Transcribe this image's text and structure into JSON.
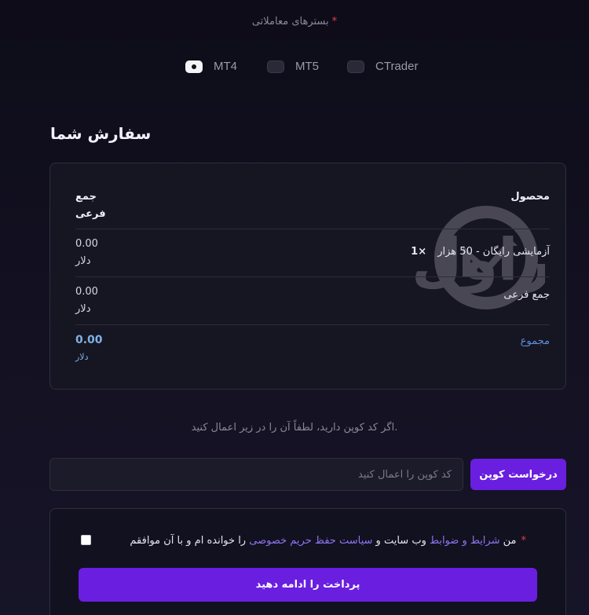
{
  "platform_field": {
    "label": "بسترهای معاملاتی",
    "required_mark": "*",
    "options": [
      {
        "label": "MT4",
        "checked": true
      },
      {
        "label": "MT5",
        "checked": false
      },
      {
        "label": "CTrader",
        "checked": false
      }
    ]
  },
  "order": {
    "title": "سفارش شما",
    "watermark_text": "بروکراول",
    "header": {
      "product": "محصول",
      "subtotal_line1": "جمع",
      "subtotal_line2": "فرعی"
    },
    "item": {
      "name": "آزمایشی رایگان - 50 هزار",
      "qty": "×1",
      "amount": "0.00",
      "currency": "دلار"
    },
    "subtotal": {
      "label": "جمع فرعی",
      "amount": "0.00",
      "currency": "دلار"
    },
    "total": {
      "label": "مجموع",
      "amount": "0.00",
      "currency": "دلار"
    }
  },
  "coupon": {
    "hint": ".اگر کد کوپن دارید، لطفاً آن را در زیر اعمال کنید",
    "placeholder": "کد کوپن را اعمال کنید",
    "button_label": "درخواست کوپن"
  },
  "terms": {
    "required_mark": "*",
    "part1": "من",
    "link1": "شرایط و ضوابط",
    "part2": "وب سایت و",
    "link2": "سیاست حفظ حریم خصوصی",
    "part3": "را خوانده ام و با آن موافقم",
    "checked": false
  },
  "pay_button_label": "پرداخت را ادامه دهید",
  "colors": {
    "accent": "#6a1ee0",
    "link": "#8f74ef",
    "total": "#7fb2e6",
    "required": "#e0414b"
  }
}
